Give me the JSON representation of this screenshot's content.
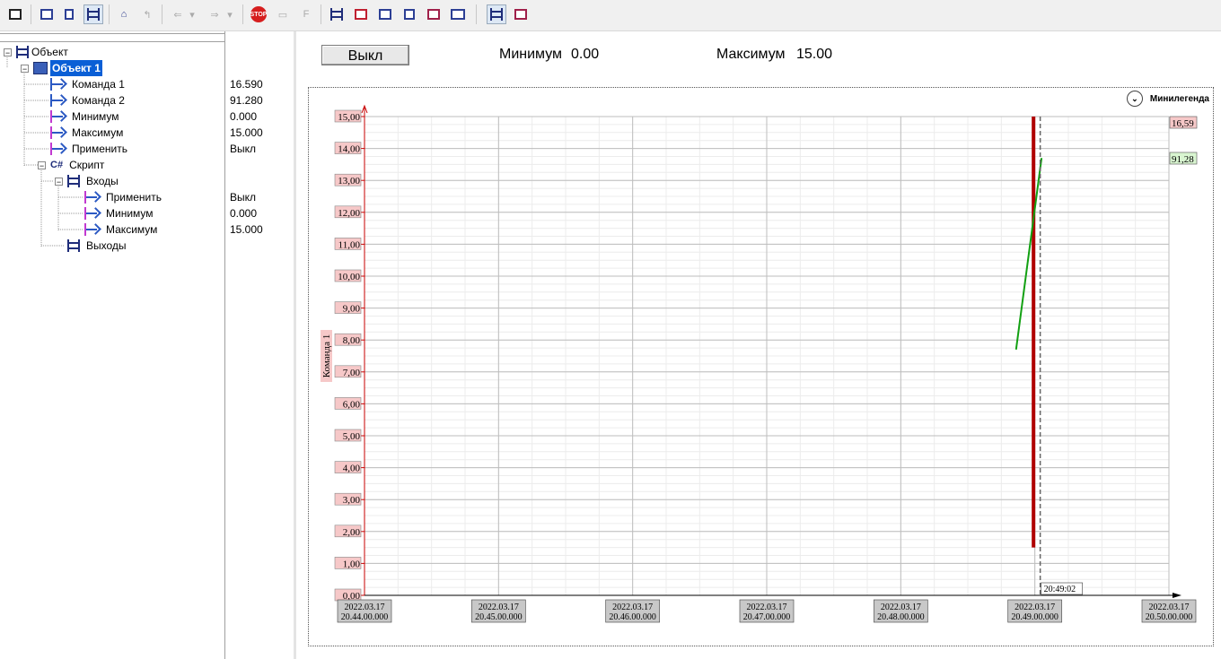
{
  "toolbar": {
    "buttons": [
      "app-icon",
      "copy-icon",
      "tree-icon",
      "object-icon",
      "home-icon",
      "up-icon",
      "back-icon",
      "forward-icon",
      "stop-icon",
      "debug-icon",
      "f-icon",
      "link-icon",
      "table-icon",
      "display-icon",
      "properties-icon",
      "book-icon",
      "window-icon",
      "grid-icon",
      "book2-icon"
    ],
    "stop_label": "STOP",
    "f_label": "F"
  },
  "tree": {
    "root": "Объект",
    "object1": "Объект 1",
    "cmd1": "Команда 1",
    "cmd2": "Команда 2",
    "min": "Минимум",
    "max": "Максимум",
    "apply": "Применить",
    "script": "Скрипт",
    "script_tag": "C#",
    "inputs": "Входы",
    "in_apply": "Применить",
    "in_min": "Минимум",
    "in_max": "Максимум",
    "outputs": "Выходы"
  },
  "values": {
    "cmd1": "16.590",
    "cmd2": "91.280",
    "min": "0.000",
    "max": "15.000",
    "apply": "Выкл",
    "in_apply": "Выкл",
    "in_min": "0.000",
    "in_max": "15.000"
  },
  "main": {
    "button_label": "Выкл",
    "min_label": "Минимум",
    "min_value": "0.00",
    "max_label": "Максимум",
    "max_value": "15.00",
    "minilegend": "Минилегенда"
  },
  "chart_data": {
    "type": "line",
    "ylabel": "Команда 1",
    "ylim": [
      0,
      15
    ],
    "y_ticks": [
      "0,00",
      "1,00",
      "2,00",
      "3,00",
      "4,00",
      "5,00",
      "6,00",
      "7,00",
      "8,00",
      "9,00",
      "10,00",
      "11,00",
      "12,00",
      "13,00",
      "14,00",
      "15,00"
    ],
    "x_ticks": [
      [
        "2022.03.17",
        "20.44.00.000"
      ],
      [
        "2022.03.17",
        "20.45.00.000"
      ],
      [
        "2022.03.17",
        "20.46.00.000"
      ],
      [
        "2022.03.17",
        "20.47.00.000"
      ],
      [
        "2022.03.17",
        "20.48.00.000"
      ],
      [
        "2022.03.17",
        "20.49.00.000"
      ],
      [
        "2022.03.17",
        "20.50.00.000"
      ]
    ],
    "x_minutes": [
      44,
      45,
      46,
      47,
      48,
      49,
      50
    ],
    "cursor_label": "20:49:02",
    "cursor_minute": 49.04,
    "series": [
      {
        "name": "Команда 1",
        "color": "#b00000",
        "end_label": "16,59",
        "points": [
          [
            48.99,
            1.5
          ],
          [
            48.99,
            15.0
          ]
        ]
      },
      {
        "name": "Команда 2",
        "color": "#12a012",
        "end_label": "91,28",
        "points": [
          [
            48.86,
            7.7
          ],
          [
            49.05,
            13.7
          ]
        ]
      }
    ]
  }
}
